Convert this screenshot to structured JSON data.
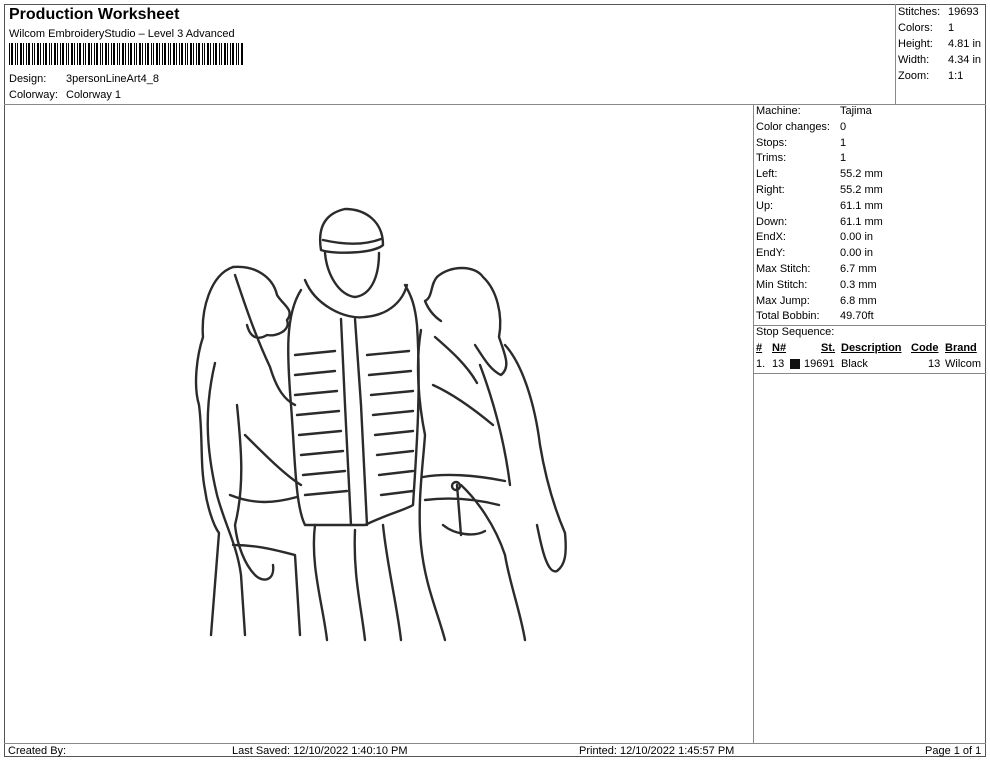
{
  "header": {
    "title": "Production Worksheet",
    "software": "Wilcom EmbroideryStudio – Level 3 Advanced",
    "design_label": "Design:",
    "design_value": "3personLineArt4_8",
    "colorway_label": "Colorway:",
    "colorway_value": "Colorway 1"
  },
  "summary": [
    {
      "label": "Stitches:",
      "value": "19693"
    },
    {
      "label": "Colors:",
      "value": "1"
    },
    {
      "label": "Height:",
      "value": "4.81 in"
    },
    {
      "label": "Width:",
      "value": "4.34 in"
    },
    {
      "label": "Zoom:",
      "value": "1:1"
    }
  ],
  "machine_params": [
    {
      "label": "Machine:",
      "value": "Tajima"
    },
    {
      "label": "Color changes:",
      "value": "0"
    },
    {
      "label": "Stops:",
      "value": "1"
    },
    {
      "label": "Trims:",
      "value": "1"
    },
    {
      "label": "Left:",
      "value": "55.2 mm"
    },
    {
      "label": "Right:",
      "value": "55.2 mm"
    },
    {
      "label": "Up:",
      "value": "61.1 mm"
    },
    {
      "label": "Down:",
      "value": "61.1 mm"
    },
    {
      "label": "EndX:",
      "value": "0.00 in"
    },
    {
      "label": "EndY:",
      "value": "0.00 in"
    },
    {
      "label": "Max Stitch:",
      "value": "6.7 mm"
    },
    {
      "label": "Min Stitch:",
      "value": "0.3 mm"
    },
    {
      "label": "Max Jump:",
      "value": "6.8 mm"
    },
    {
      "label": "Total Bobbin:",
      "value": "49.70ft"
    }
  ],
  "stop_sequence": {
    "title": "Stop Sequence:",
    "headers": {
      "num": "#",
      "n": "N#",
      "st": "St.",
      "desc": "Description",
      "code": "Code",
      "brand": "Brand"
    },
    "rows": [
      {
        "num": "1.",
        "n": "13",
        "st": "19691",
        "desc": "Black",
        "code": "13",
        "brand": "Wilcom",
        "color": "#111111"
      }
    ]
  },
  "footer": {
    "created_by": "Created By:",
    "last_saved": "Last Saved: 12/10/2022 1:40:10 PM",
    "printed": "Printed: 12/10/2022 1:45:57 PM",
    "page": "Page 1 of 1"
  },
  "design_preview": {
    "stitch_color": "#2b2b2b",
    "subject": "three-person-line-art"
  }
}
